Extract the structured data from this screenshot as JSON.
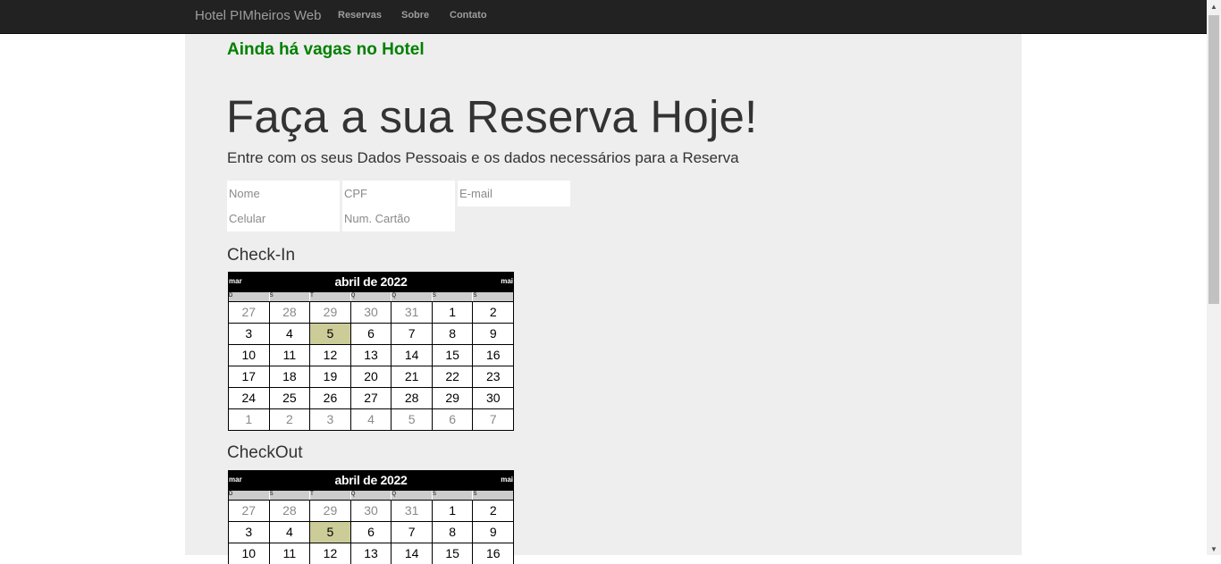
{
  "navbar": {
    "brand": "Hotel PIMheiros Web",
    "links": [
      "Reservas",
      "Sobre",
      "Contato"
    ]
  },
  "alert": "Ainda há vagas no Hotel",
  "headline": "Faça a sua Reserva Hoje!",
  "lead": "Entre com os seus Dados Pessoais e os dados necessários para a Reserva",
  "form": {
    "nome_placeholder": "Nome",
    "cpf_placeholder": "CPF",
    "email_placeholder": "E-mail",
    "celular_placeholder": "Celular",
    "cartao_placeholder": "Num. Cartão"
  },
  "checkin": {
    "label": "Check-In",
    "prev": "mar",
    "next": "mai",
    "month": "abril de 2022",
    "weekdays": [
      "D",
      "S",
      "T",
      "Q",
      "Q",
      "S",
      "S"
    ],
    "weeks": [
      [
        "27",
        "28",
        "29",
        "30",
        "31",
        "1",
        "2"
      ],
      [
        "3",
        "4",
        "5",
        "6",
        "7",
        "8",
        "9"
      ],
      [
        "10",
        "11",
        "12",
        "13",
        "14",
        "15",
        "16"
      ],
      [
        "17",
        "18",
        "19",
        "20",
        "21",
        "22",
        "23"
      ],
      [
        "24",
        "25",
        "26",
        "27",
        "28",
        "29",
        "30"
      ],
      [
        "1",
        "2",
        "3",
        "4",
        "5",
        "6",
        "7"
      ]
    ]
  },
  "checkout": {
    "label": "CheckOut",
    "prev": "mar",
    "next": "mai",
    "month": "abril de 2022",
    "weekdays": [
      "D",
      "S",
      "T",
      "Q",
      "Q",
      "S",
      "S"
    ],
    "weeks": [
      [
        "27",
        "28",
        "29",
        "30",
        "31",
        "1",
        "2"
      ],
      [
        "3",
        "4",
        "5",
        "6",
        "7",
        "8",
        "9"
      ],
      [
        "10",
        "11",
        "12",
        "13",
        "14",
        "15",
        "16"
      ]
    ]
  },
  "icons": {
    "scroll_up": "triangle-up",
    "scroll_down": "triangle-down"
  },
  "colors": {
    "navbar_bg": "#222222",
    "alert_green": "#008000",
    "jumbotron_bg": "#eeeeee",
    "selected_day": "#cccc99"
  }
}
